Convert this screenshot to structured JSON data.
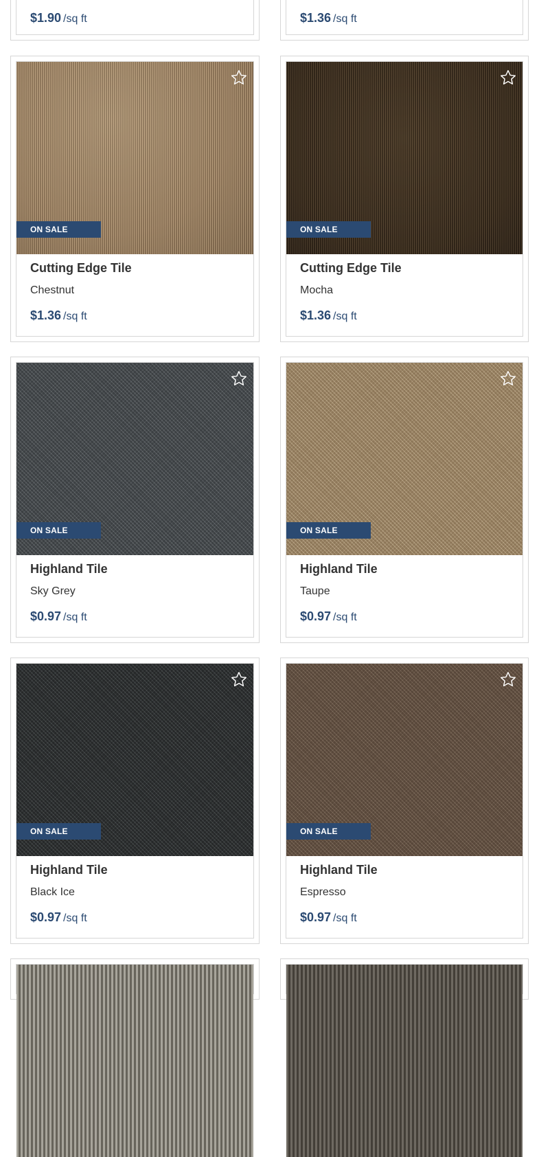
{
  "badge_label": "ON SALE",
  "unit_label": "/sq ft",
  "colors": {
    "accent": "#2b4a72",
    "border": "#d6d6d6",
    "text": "#333333"
  },
  "top_row": [
    {
      "price": "$1.90"
    },
    {
      "price": "$1.36"
    }
  ],
  "products": [
    {
      "name": "Cutting Edge Tile",
      "color": "Chestnut",
      "price": "$1.36",
      "swatch": "#a48766",
      "favorite_icon": "star-outline-icon"
    },
    {
      "name": "Cutting Edge Tile",
      "color": "Mocha",
      "price": "$1.36",
      "swatch": "#3e2f1f",
      "favorite_icon": "star-outline-icon"
    },
    {
      "name": "Highland Tile",
      "color": "Sky Grey",
      "price": "$0.97",
      "swatch": "#4e5357",
      "favorite_icon": "star-outline-icon"
    },
    {
      "name": "Highland Tile",
      "color": "Taupe",
      "price": "$0.97",
      "swatch": "#a8916f",
      "favorite_icon": "star-outline-icon"
    },
    {
      "name": "Highland Tile",
      "color": "Black Ice",
      "price": "$0.97",
      "swatch": "#35393a",
      "favorite_icon": "star-outline-icon"
    },
    {
      "name": "Highland Tile",
      "color": "Espresso",
      "price": "$0.97",
      "swatch": "#6b5849",
      "favorite_icon": "star-outline-icon"
    }
  ]
}
